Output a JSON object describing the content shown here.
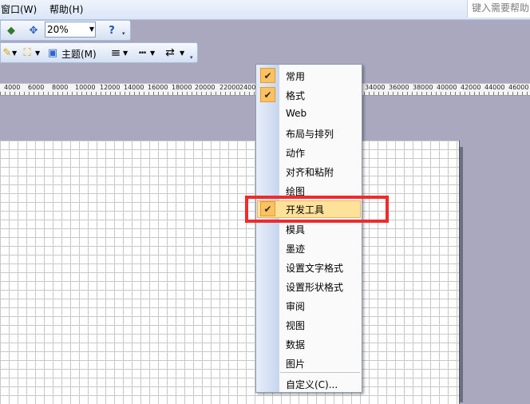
{
  "menubar": {
    "window": "窗口(W)",
    "help": "帮助(H)"
  },
  "help_box": {
    "placeholder": "键入需要帮助"
  },
  "toolbar1": {
    "zoom": "20%"
  },
  "toolbar2": {
    "theme": "主题(M)"
  },
  "ruler": {
    "ticks": [
      "4000",
      "6000",
      "8000",
      "10000",
      "12000",
      "14000",
      "16000",
      "18000",
      "20000",
      "22000",
      "2400",
      "34000",
      "36000",
      "38000",
      "40000",
      "42000",
      "44000",
      "46000"
    ]
  },
  "context_menu": {
    "items": [
      {
        "label": "常用",
        "checked": true
      },
      {
        "label": "格式",
        "checked": true
      },
      {
        "label": "Web",
        "checked": false
      },
      {
        "label": "布局与排列",
        "checked": false
      },
      {
        "label": "动作",
        "checked": false
      },
      {
        "label": "对齐和粘附",
        "checked": false
      },
      {
        "label": "绘图",
        "checked": false
      },
      {
        "label": "开发工具",
        "checked": true,
        "highlighted": true
      },
      {
        "label": "模具",
        "checked": false
      },
      {
        "label": "墨迹",
        "checked": false
      },
      {
        "label": "设置文字格式",
        "checked": false
      },
      {
        "label": "设置形状格式",
        "checked": false
      },
      {
        "label": "审阅",
        "checked": false
      },
      {
        "label": "视图",
        "checked": false
      },
      {
        "label": "数据",
        "checked": false
      },
      {
        "label": "图片",
        "checked": false
      }
    ],
    "customize": "自定义(C)..."
  },
  "colors": {
    "highlight": "#ffe29a",
    "check": "#fcc261",
    "annotation": "#f12b2b"
  }
}
